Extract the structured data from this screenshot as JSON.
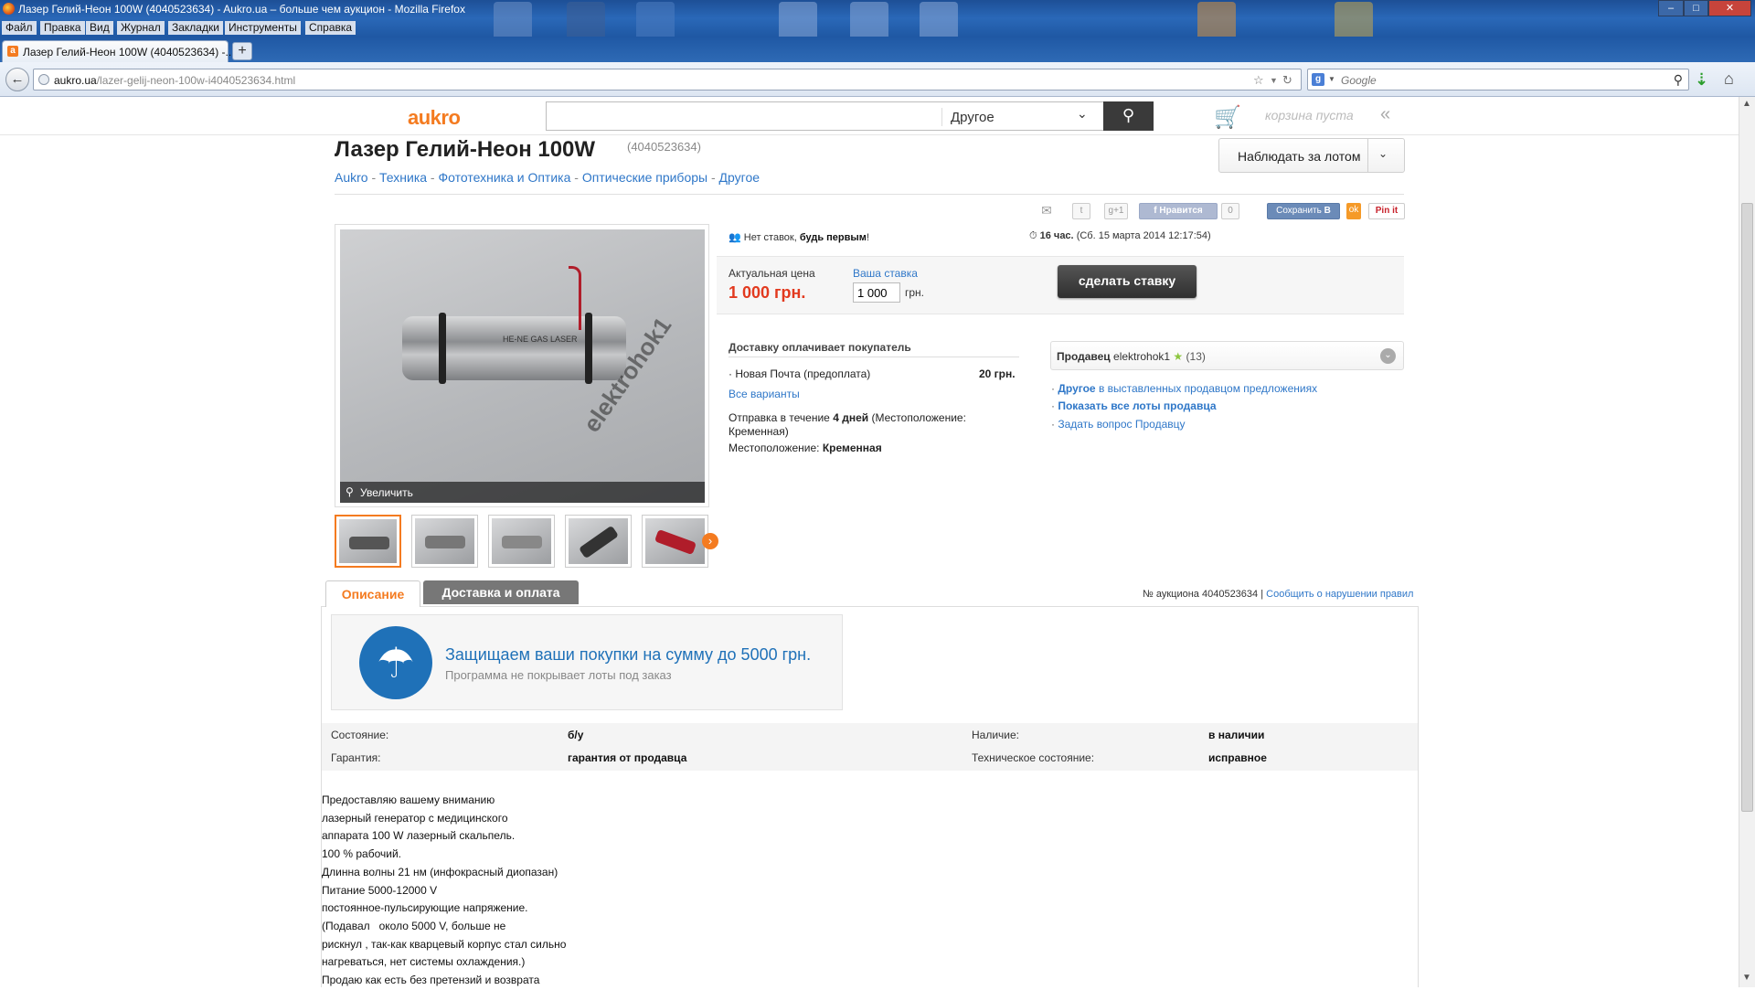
{
  "window": {
    "title": "Лазер Гелий-Неон 100W (4040523634) - Aukro.ua – больше чем аукцион - Mozilla Firefox",
    "controls": [
      "–",
      "□",
      "✕"
    ]
  },
  "menu": [
    "Файл",
    "Правка",
    "Вид",
    "Журнал",
    "Закладки",
    "Инструменты",
    "Справка"
  ],
  "tab": {
    "title": "Лазер Гелий-Неон 100W (4040523634) -...",
    "new_tab": "+"
  },
  "nav": {
    "url_domain": "aukro.ua",
    "url_path": "/lazer-gelij-neon-100w-i4040523634.html",
    "search_placeholder": "Google"
  },
  "header": {
    "logo": "aukro",
    "category": "Другое",
    "cart": "корзина пуста"
  },
  "product": {
    "title": "Лазер Гелий-Неон 100W",
    "id": "(4040523634)",
    "watch": "Наблюдать за лотом",
    "breadcrumbs": [
      "Aukro",
      "Техника",
      "Фототехника и Оптика",
      "Оптические приборы",
      "Другое"
    ],
    "zoom": "Увеличить",
    "watermark": "elektrohok1"
  },
  "share": {
    "gplus": "g+1",
    "like": "Нравится",
    "like_count": "0",
    "save": "Сохранить",
    "pin": "Pin it"
  },
  "bid": {
    "no_bids_1": "Нет ставок,",
    "no_bids_2": "будь первым",
    "no_bids_3": "!",
    "time_left": "16 час.",
    "end": "(Сб. 15 марта 2014 12:17:54)",
    "price_label": "Актуальная цена",
    "price": "1 000 грн.",
    "your_bid_label": "Ваша ставка",
    "your_bid_value": "1 000",
    "currency": "грн.",
    "button": "сделать ставку"
  },
  "delivery": {
    "heading": "Доставку оплачивает покупатель",
    "option": "Новая Почта (предоплата)",
    "option_price": "20 грн.",
    "all": "Все варианты",
    "ship_1": "Отправка в течение",
    "ship_days": "4 дней",
    "ship_2": "(Местоположение: Кременная)",
    "location_label": "Местоположение:",
    "location": "Кременная"
  },
  "seller": {
    "label": "Продавец",
    "name": "elektrohok1",
    "rating": "(13)",
    "link1_b": "Другое",
    "link1": "в выставленных продавцом предложениях",
    "link2": "Показать все лоты продавца",
    "link3": "Задать вопрос Продавцу"
  },
  "tabs": {
    "description": "Описание",
    "delivery": "Доставка и оплата"
  },
  "auction_no": "№ аукциона 4040523634",
  "report": "Сообщить о нарушении правил",
  "promo": {
    "headline": "Защищаем ваши покупки на сумму до 5000 грн.",
    "sub": "Программа не покрывает лоты под заказ"
  },
  "params": [
    {
      "k": "Состояние:",
      "v": "б/у",
      "k2": "Наличие:",
      "v2": "в наличии"
    },
    {
      "k": "Гарантия:",
      "v": "гарантия от продавца",
      "k2": "Техническое состояние:",
      "v2": "исправное"
    }
  ],
  "description": [
    "Предоставляю вашему вниманию",
    "лазерный генератор с медицинского",
    "аппарата 100 W лазерный скальпель.",
    "100 % рабочий.",
    "Длинна волны 21 нм (инфокрасный диопазан)",
    "Питание 5000-12000 V",
    "постоянное-пульсирующие напряжение.",
    "(Подавал   около 5000 V, больше не",
    "рискнул , так-как кварцевый корпус стал сильно",
    "нагреваться, нет системы охлаждения.)",
    "Продаю как есть без претензий и возврата"
  ],
  "colors": {
    "accent": "#f47b20",
    "link": "#2f77c8",
    "price": "#e2391e",
    "promo": "#1f71b8"
  }
}
